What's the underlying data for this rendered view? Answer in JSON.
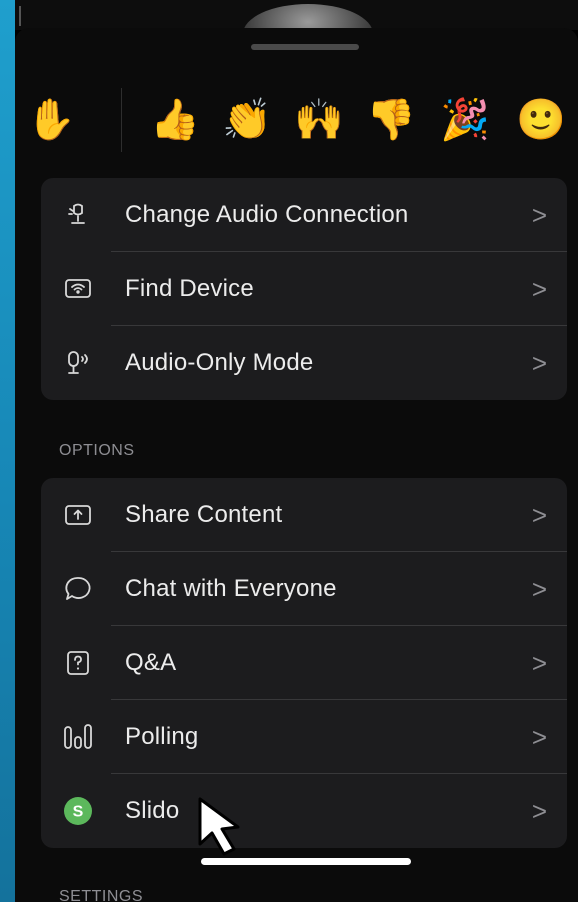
{
  "reactions": [
    {
      "name": "raise-hand",
      "glyph": "✋"
    },
    {
      "name": "thumbs-up",
      "glyph": "👍"
    },
    {
      "name": "clapping-hands",
      "glyph": "👏"
    },
    {
      "name": "raising-hands",
      "glyph": "🙌"
    },
    {
      "name": "thumbs-down",
      "glyph": "👎"
    },
    {
      "name": "party-popper",
      "glyph": "🎉"
    },
    {
      "name": "smiley-face",
      "glyph": "🙂"
    }
  ],
  "audio_group": {
    "items": [
      {
        "label": "Change Audio Connection",
        "icon": "audio-connection-icon"
      },
      {
        "label": "Find Device",
        "icon": "find-device-icon"
      },
      {
        "label": "Audio-Only Mode",
        "icon": "audio-only-icon"
      }
    ]
  },
  "options": {
    "section_label": "OPTIONS",
    "items": [
      {
        "label": "Share Content",
        "icon": "share-content-icon"
      },
      {
        "label": "Chat with Everyone",
        "icon": "chat-bubble-icon"
      },
      {
        "label": "Q&A",
        "icon": "qa-icon"
      },
      {
        "label": "Polling",
        "icon": "polling-icon"
      },
      {
        "label": "Slido",
        "icon": "slido-icon"
      }
    ]
  },
  "settings": {
    "section_label": "SETTINGS"
  },
  "chevron": ">",
  "colors": {
    "background_outer": "#1787b6",
    "sheet": "#0b0b0b",
    "group": "#1c1c1e",
    "label": "#ececec",
    "secondary": "#8e8e93",
    "slido_green": "#5cb85c",
    "emoji_yellow": "#f7b733"
  }
}
